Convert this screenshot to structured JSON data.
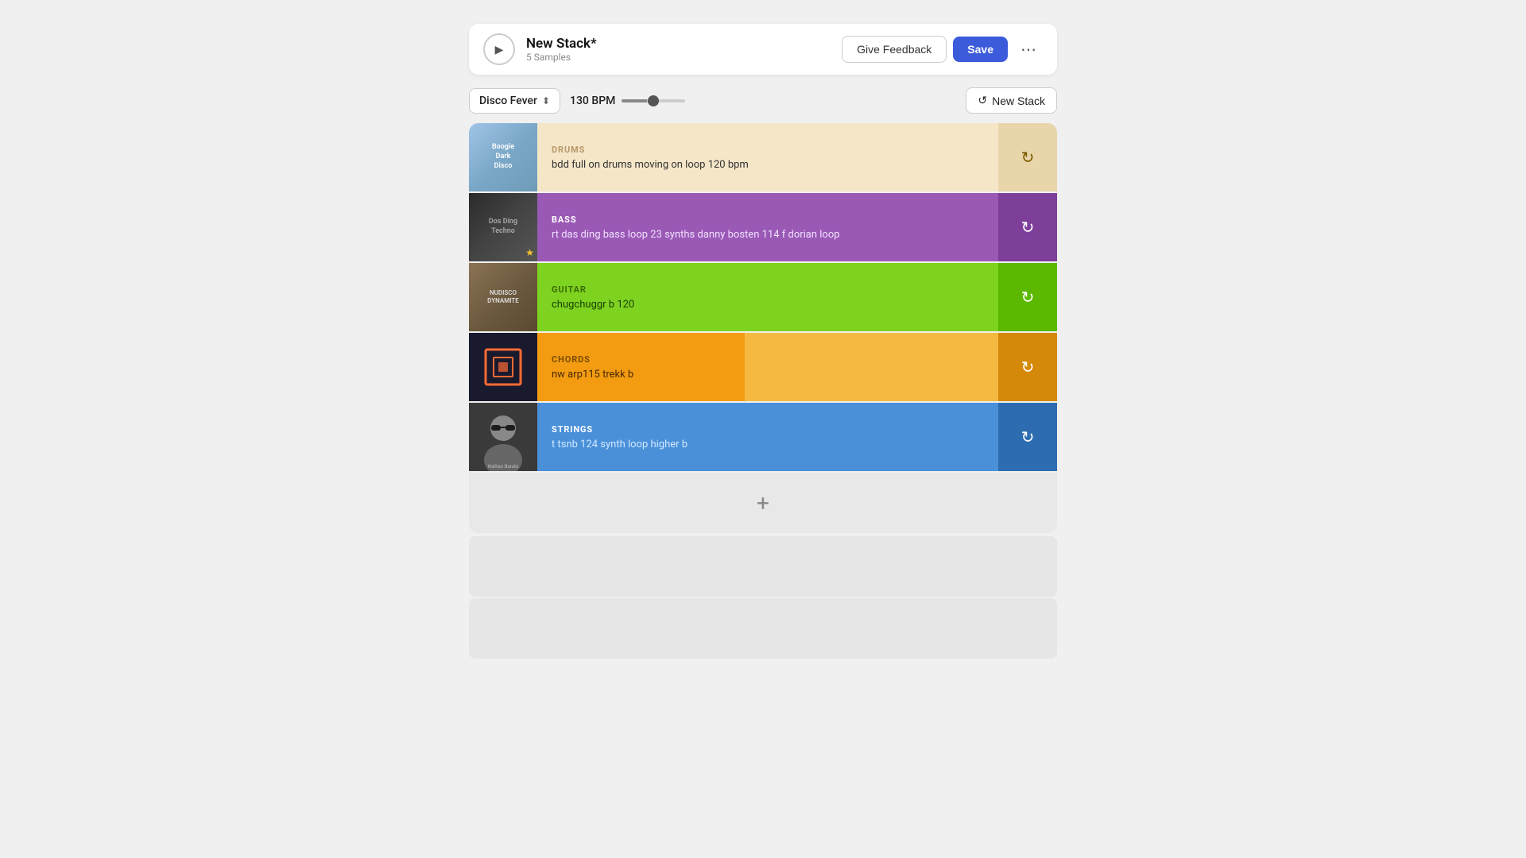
{
  "header": {
    "play_label": "▶",
    "title": "New Stack*",
    "subtitle": "5 Samples",
    "feedback_label": "Give Feedback",
    "save_label": "Save",
    "more_icon": "⋯"
  },
  "toolbar": {
    "genre": "Disco Fever",
    "bpm_label": "130 BPM",
    "bpm_value": 50,
    "new_stack_label": "New Stack"
  },
  "tracks": [
    {
      "id": "drums",
      "category": "DRUMS",
      "description": "bdd full on drums moving on loop 120 bpm",
      "thumb_class": "thumb-drums",
      "thumb_label": "Boogie\nDark\nDisco",
      "content_class": "drums-content",
      "category_class": "drums-category",
      "refresh_class": "drums-refresh",
      "refresh_color": "#5a4000"
    },
    {
      "id": "bass",
      "category": "BASS",
      "description": "rt das ding bass loop 23 synths danny bosten 114 f dorian loop",
      "thumb_class": "thumb-bass",
      "thumb_label": "Dos Ding\nTechno",
      "content_class": "bass-content",
      "category_class": "bass-category",
      "refresh_class": "bass-refresh",
      "has_star": true
    },
    {
      "id": "guitar",
      "category": "GUITAR",
      "description": "chugchuggr b 120",
      "thumb_class": "thumb-guitar",
      "thumb_label": "Nudisco\nDynamite",
      "content_class": "guitar-content",
      "category_class": "guitar-category",
      "refresh_class": "guitar-refresh"
    },
    {
      "id": "chords",
      "category": "CHORDS",
      "description": "nw arp115 trekk b",
      "thumb_class": "thumb-chords",
      "thumb_label": "",
      "content_class": "chords-content",
      "category_class": "chords-category",
      "refresh_class": "chords-refresh"
    },
    {
      "id": "strings",
      "category": "STRINGS",
      "description": "t tsnb 124 synth loop higher b",
      "thumb_class": "thumb-strings",
      "thumb_label": "Nathan\nBarato",
      "content_class": "strings-content",
      "category_class": "strings-category",
      "refresh_class": "strings-refresh"
    }
  ],
  "add_track": {
    "icon": "+"
  },
  "icons": {
    "refresh": "↻",
    "new_stack": "↺",
    "chevron": "⬍"
  }
}
